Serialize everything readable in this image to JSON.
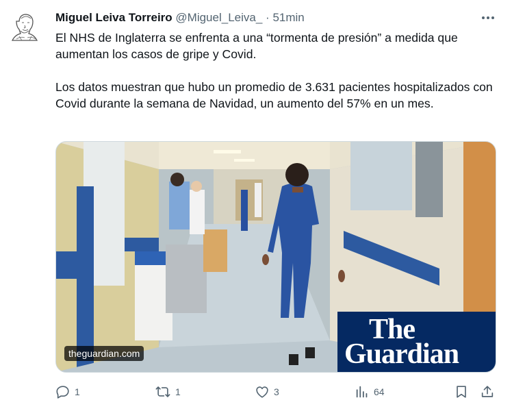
{
  "tweet": {
    "author_name": "Miguel Leiva Torreiro",
    "author_handle": "@Miguel_Leiva_",
    "separator": "·",
    "timestamp": "51min",
    "paragraphs": [
      "El NHS de Inglaterra se enfrenta a una “tormenta de presión” a medida que aumentan los casos de gripe y Covid.",
      "Los  datos muestran que hubo un promedio de 3.631 pacientes hospitalizados con Covid durante la semana de Navidad, un aumento del 57% en un mes."
    ]
  },
  "card": {
    "domain": "theguardian.com",
    "logo_line1": "The",
    "logo_line2": "Guardian",
    "brand_color": "#052962"
  },
  "actions": {
    "reply_count": "1",
    "retweet_count": "1",
    "like_count": "3",
    "views_count": "64"
  },
  "icons": [
    "more-icon",
    "reply-icon",
    "retweet-icon",
    "like-icon",
    "views-icon",
    "bookmark-icon",
    "share-icon"
  ]
}
